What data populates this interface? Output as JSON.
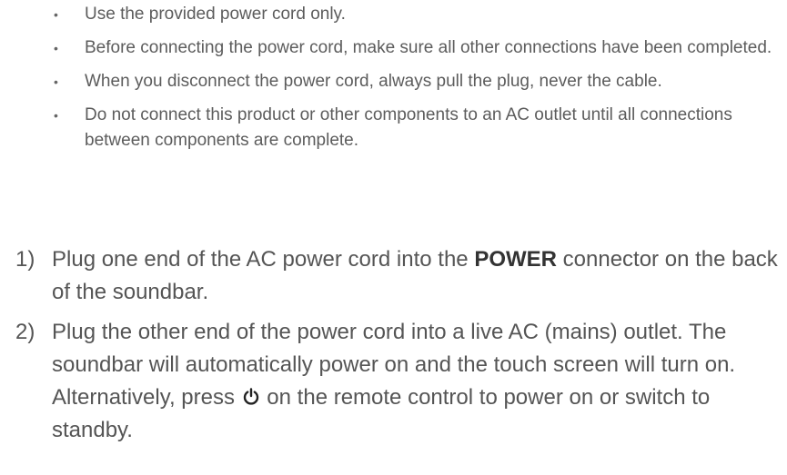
{
  "notes": [
    "Use the provided power cord only.",
    "Before connecting the power cord, make sure all other connections have been completed.",
    "When you disconnect the power cord, always pull the plug, never the cable.",
    "Do not connect this product or other components to an AC outlet until all connections between components are complete."
  ],
  "bullet": "•",
  "steps": {
    "step1": {
      "number": "1)",
      "text_before": "Plug one end of the AC power cord into the ",
      "bold": "POWER",
      "text_after": " connector on the back of the soundbar."
    },
    "step2": {
      "number": "2)",
      "text_before": "Plug the other end of the power cord into a live AC (mains) outlet. The soundbar will automatically power on and the touch screen will turn on. Alternatively, press ",
      "icon": "power-icon",
      "text_after": " on the remote control to power on or switch to standby."
    }
  }
}
